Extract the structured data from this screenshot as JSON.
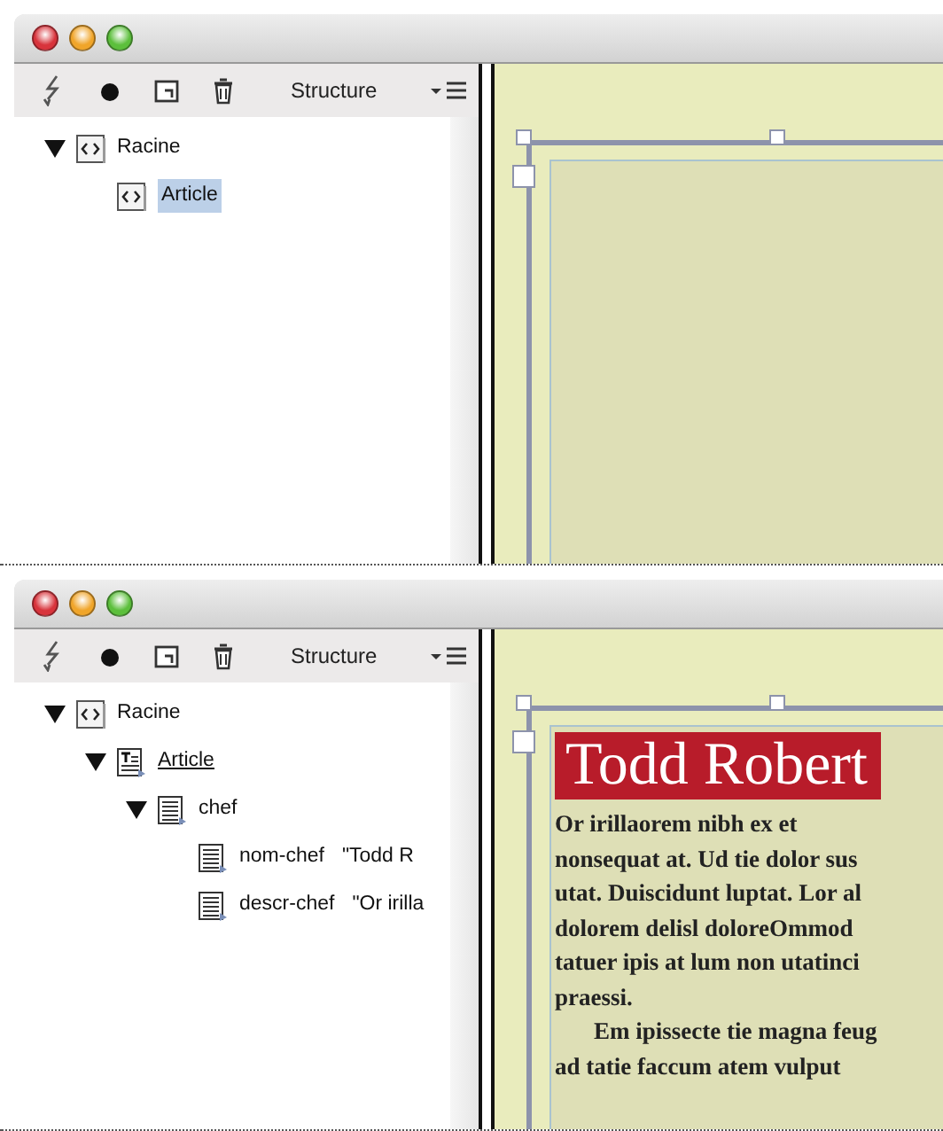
{
  "panels": [
    {
      "toolbar": {
        "title": "Structure"
      },
      "tree": [
        {
          "label": "Racine",
          "kind": "tag",
          "expanded": true,
          "selected": false,
          "underlined": false,
          "children": [
            {
              "label": "Article",
              "kind": "tag",
              "selected": true,
              "underlined": false
            }
          ]
        }
      ]
    },
    {
      "toolbar": {
        "title": "Structure"
      },
      "tree": [
        {
          "label": "Racine",
          "kind": "tag",
          "expanded": true,
          "selected": false,
          "underlined": false,
          "children": [
            {
              "label": "Article",
              "kind": "text-frame",
              "expanded": true,
              "selected": false,
              "underlined": true,
              "children": [
                {
                  "label": "chef",
                  "kind": "text",
                  "expanded": true,
                  "selected": false,
                  "underlined": false,
                  "children": [
                    {
                      "label": "nom-chef",
                      "value": "\"Todd R",
                      "kind": "text",
                      "selected": false,
                      "underlined": false
                    },
                    {
                      "label": "descr-chef",
                      "value": "\"Or irilla",
                      "kind": "text",
                      "selected": false,
                      "underlined": false
                    }
                  ]
                }
              ]
            }
          ]
        }
      ],
      "canvas": {
        "heading": "Todd Robert",
        "paragraphs": [
          {
            "lines": [
              "Or irillaorem nibh ex et",
              "nonsequat at. Ud tie dolor sus",
              "utat. Duiscidunt luptat. Lor al",
              "dolorem delisl doloreOmmod",
              "tatuer ipis at lum non utatinci",
              "praessi."
            ]
          },
          {
            "lines": [
              "Em ipissecte tie magna feug",
              "ad tatie faccum atem vulput"
            ]
          }
        ]
      }
    }
  ]
}
